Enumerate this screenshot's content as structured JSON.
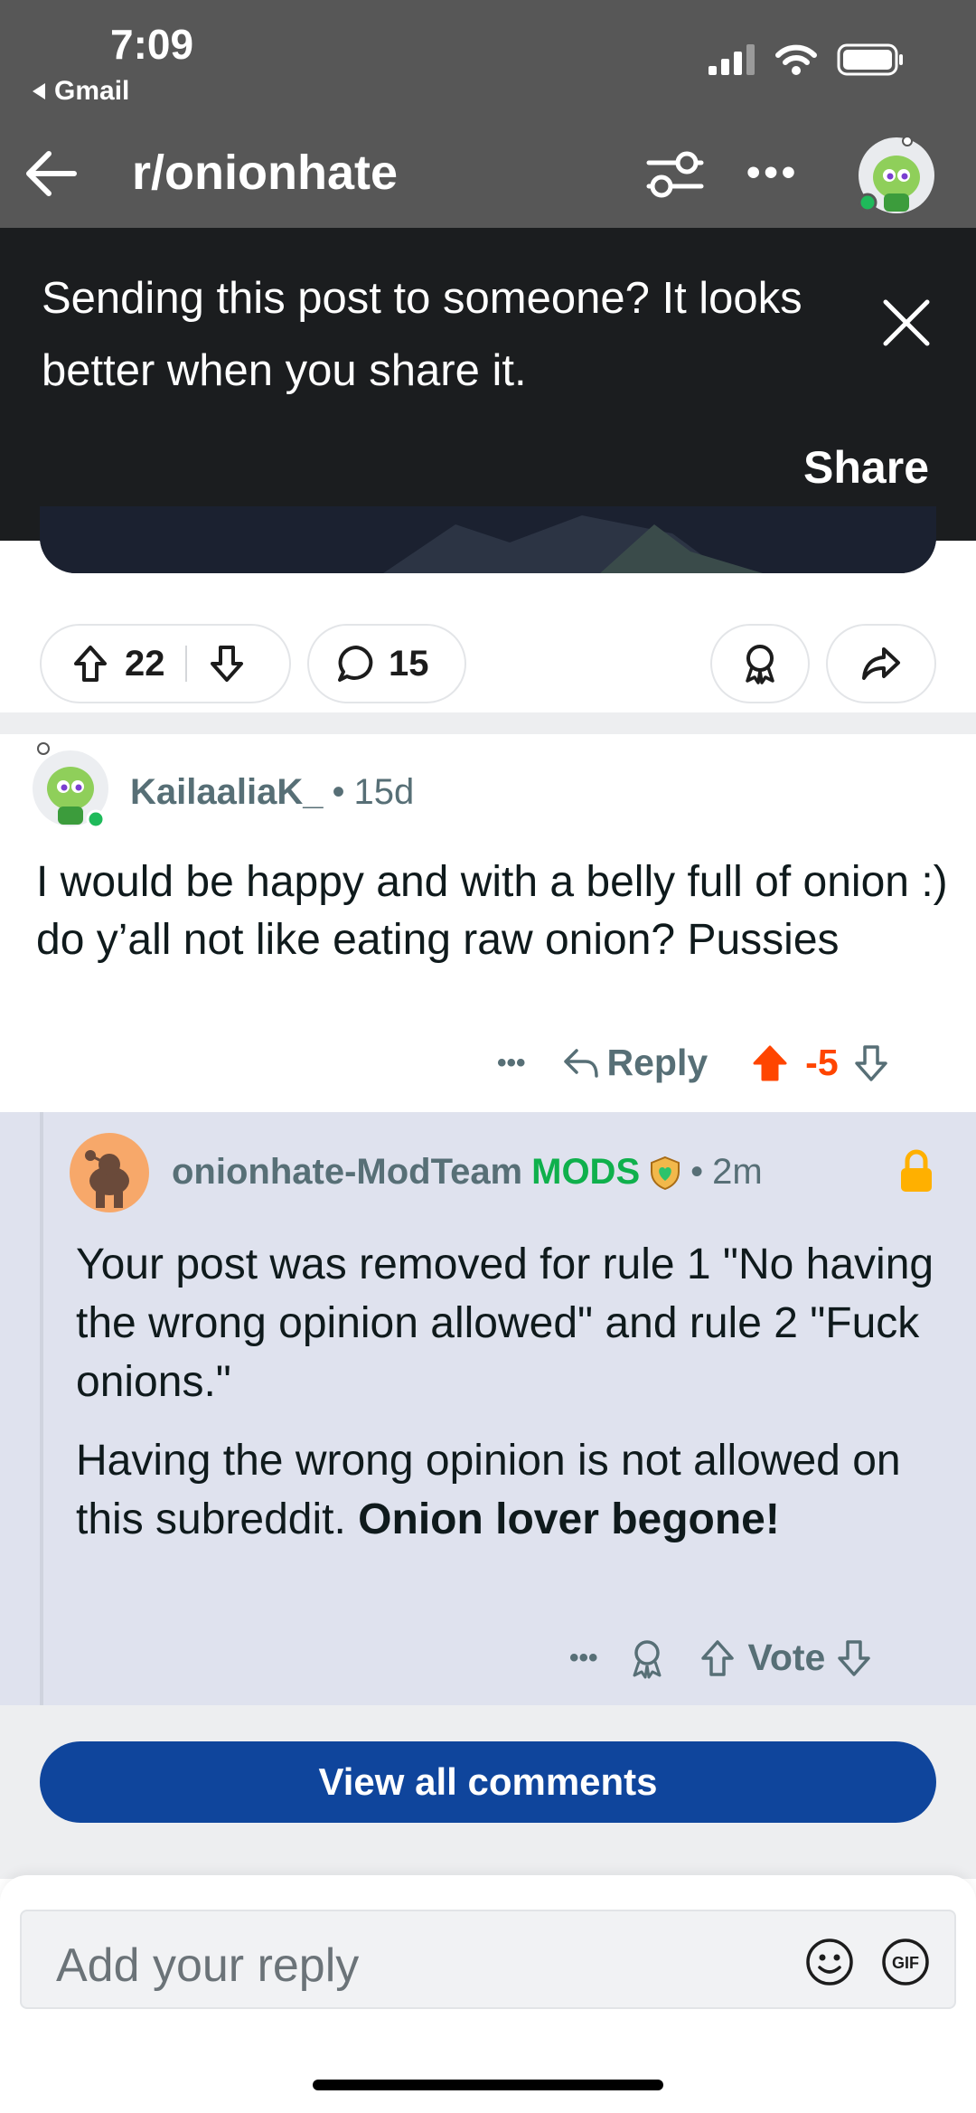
{
  "status": {
    "time": "7:09",
    "back_app": "Gmail"
  },
  "header": {
    "title": "r/onionhate"
  },
  "banner": {
    "message": "Sending this post to someone? It looks better when you share it.",
    "share_label": "Share"
  },
  "post_actions": {
    "upvotes": "22",
    "comments": "15"
  },
  "comment1": {
    "username": "KailaaliaK_",
    "age": "15d",
    "body": "I would be happy and with a belly full of onion :) do y’all not like eating raw onion? Pussies",
    "more_label": "•••",
    "reply_label": "Reply",
    "score": "-5"
  },
  "comment2": {
    "username": "onionhate-ModTeam",
    "mods_badge": "MODS",
    "age": "2m",
    "paragraph1": "Your post was removed for rule 1 \"No having the wrong opinion allowed\" and rule 2 \"Fuck onions.\"",
    "paragraph2_plain": "Having the wrong opinion is not allowed on this subreddit. ",
    "paragraph2_bold": "Onion lover begone!",
    "more_label": "•••",
    "vote_label": "Vote"
  },
  "view_all_label": "View all comments",
  "reply_bar": {
    "placeholder": "Add your reply",
    "gif_label": "GIF"
  },
  "colors": {
    "downvoted": "#ff4500",
    "mod_green": "#0fb04c",
    "button_blue": "#0f459c",
    "lock_yellow": "#ffb000"
  }
}
